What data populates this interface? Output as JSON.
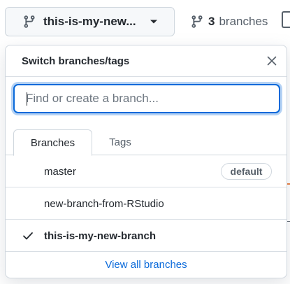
{
  "toolbar": {
    "branch_button_label": "this-is-my-new...",
    "branch_count": "3",
    "branches_label": "branches"
  },
  "dropdown": {
    "title": "Switch branches/tags",
    "search": {
      "placeholder": "Find or create a branch...",
      "value": ""
    },
    "tabs": [
      {
        "label": "Branches",
        "active": true
      },
      {
        "label": "Tags",
        "active": false
      }
    ],
    "branches": [
      {
        "name": "master",
        "badge": "default",
        "selected": false
      },
      {
        "name": "new-branch-from-RStudio",
        "badge": "",
        "selected": false
      },
      {
        "name": "this-is-my-new-branch",
        "badge": "",
        "selected": true
      }
    ],
    "footer_link": "View all branches"
  },
  "colors": {
    "accent": "#0969da",
    "text": "#24292f",
    "muted": "#57606a",
    "border": "#d0d7de"
  },
  "icons": {
    "branch": "git-branch-icon",
    "caret": "triangle-down-icon",
    "close": "x-icon",
    "check": "check-icon"
  }
}
